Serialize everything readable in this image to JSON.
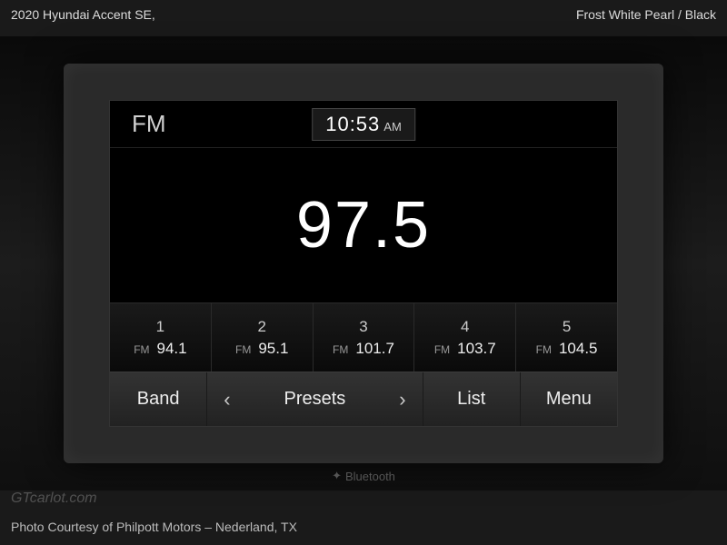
{
  "header": {
    "vehicle": "2020 Hyundai Accent SE,",
    "colors": "Frost White Pearl / Black"
  },
  "radio": {
    "band": "FM",
    "clock_time": "10:53",
    "clock_ampm": "AM",
    "frequency": "97.5",
    "presets": [
      {
        "num": "1",
        "band": "FM",
        "freq": "94.1"
      },
      {
        "num": "2",
        "band": "FM",
        "freq": "95.1"
      },
      {
        "num": "3",
        "band": "FM",
        "freq": "101.7"
      },
      {
        "num": "4",
        "band": "FM",
        "freq": "103.7"
      },
      {
        "num": "5",
        "band": "FM",
        "freq": "104.5"
      }
    ],
    "controls": {
      "band": "Band",
      "presets": "Presets",
      "list": "List",
      "menu": "Menu"
    }
  },
  "bluetooth_label": "Bluetooth",
  "watermark": "GTcarlot.com",
  "credit": "Photo Courtesy of Philpott Motors – Nederland, TX"
}
